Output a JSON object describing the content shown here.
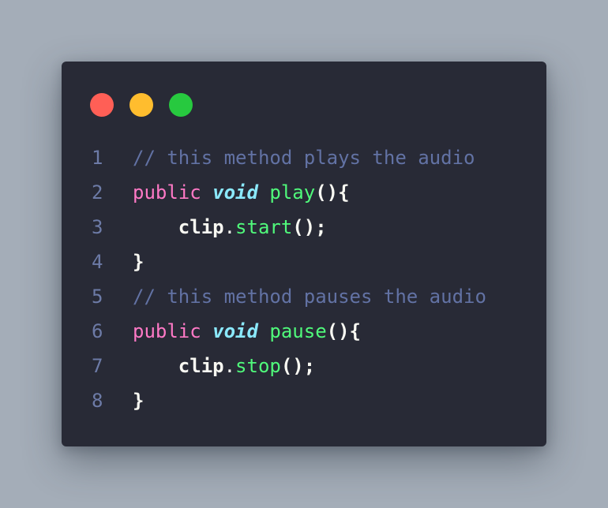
{
  "window": {
    "background": "#282a36",
    "controls": [
      {
        "name": "close",
        "color": "#ff5f56"
      },
      {
        "name": "minimize",
        "color": "#ffbd2e"
      },
      {
        "name": "maximize",
        "color": "#27c93f"
      }
    ]
  },
  "colors": {
    "comment": "#6272a4",
    "keyword": "#ff79c6",
    "type": "#8be9fd",
    "function": "#50fa7b",
    "text": "#f8f8f2",
    "line_number": "#6d7ba7"
  },
  "code": {
    "lines": [
      {
        "number": "1",
        "tokens": [
          {
            "kind": "comment",
            "text": "// this method plays the audio"
          }
        ]
      },
      {
        "number": "2",
        "tokens": [
          {
            "kind": "keyword",
            "text": "public"
          },
          {
            "kind": "plain",
            "text": " "
          },
          {
            "kind": "type",
            "text": "void"
          },
          {
            "kind": "plain",
            "text": " "
          },
          {
            "kind": "func",
            "text": "play"
          },
          {
            "kind": "punct",
            "text": "(){"
          }
        ]
      },
      {
        "number": "3",
        "tokens": [
          {
            "kind": "plain",
            "text": "    clip"
          },
          {
            "kind": "dot",
            "text": "."
          },
          {
            "kind": "func",
            "text": "start"
          },
          {
            "kind": "punct",
            "text": "();"
          }
        ]
      },
      {
        "number": "4",
        "tokens": [
          {
            "kind": "punct",
            "text": "}"
          }
        ]
      },
      {
        "number": "5",
        "tokens": [
          {
            "kind": "comment",
            "text": "// this method pauses the audio"
          }
        ]
      },
      {
        "number": "6",
        "tokens": [
          {
            "kind": "keyword",
            "text": "public"
          },
          {
            "kind": "plain",
            "text": " "
          },
          {
            "kind": "type",
            "text": "void"
          },
          {
            "kind": "plain",
            "text": " "
          },
          {
            "kind": "func",
            "text": "pause"
          },
          {
            "kind": "punct",
            "text": "(){"
          }
        ]
      },
      {
        "number": "7",
        "tokens": [
          {
            "kind": "plain",
            "text": "    clip"
          },
          {
            "kind": "dot",
            "text": "."
          },
          {
            "kind": "func",
            "text": "stop"
          },
          {
            "kind": "punct",
            "text": "();"
          }
        ]
      },
      {
        "number": "8",
        "tokens": [
          {
            "kind": "punct",
            "text": "}"
          }
        ]
      }
    ]
  }
}
